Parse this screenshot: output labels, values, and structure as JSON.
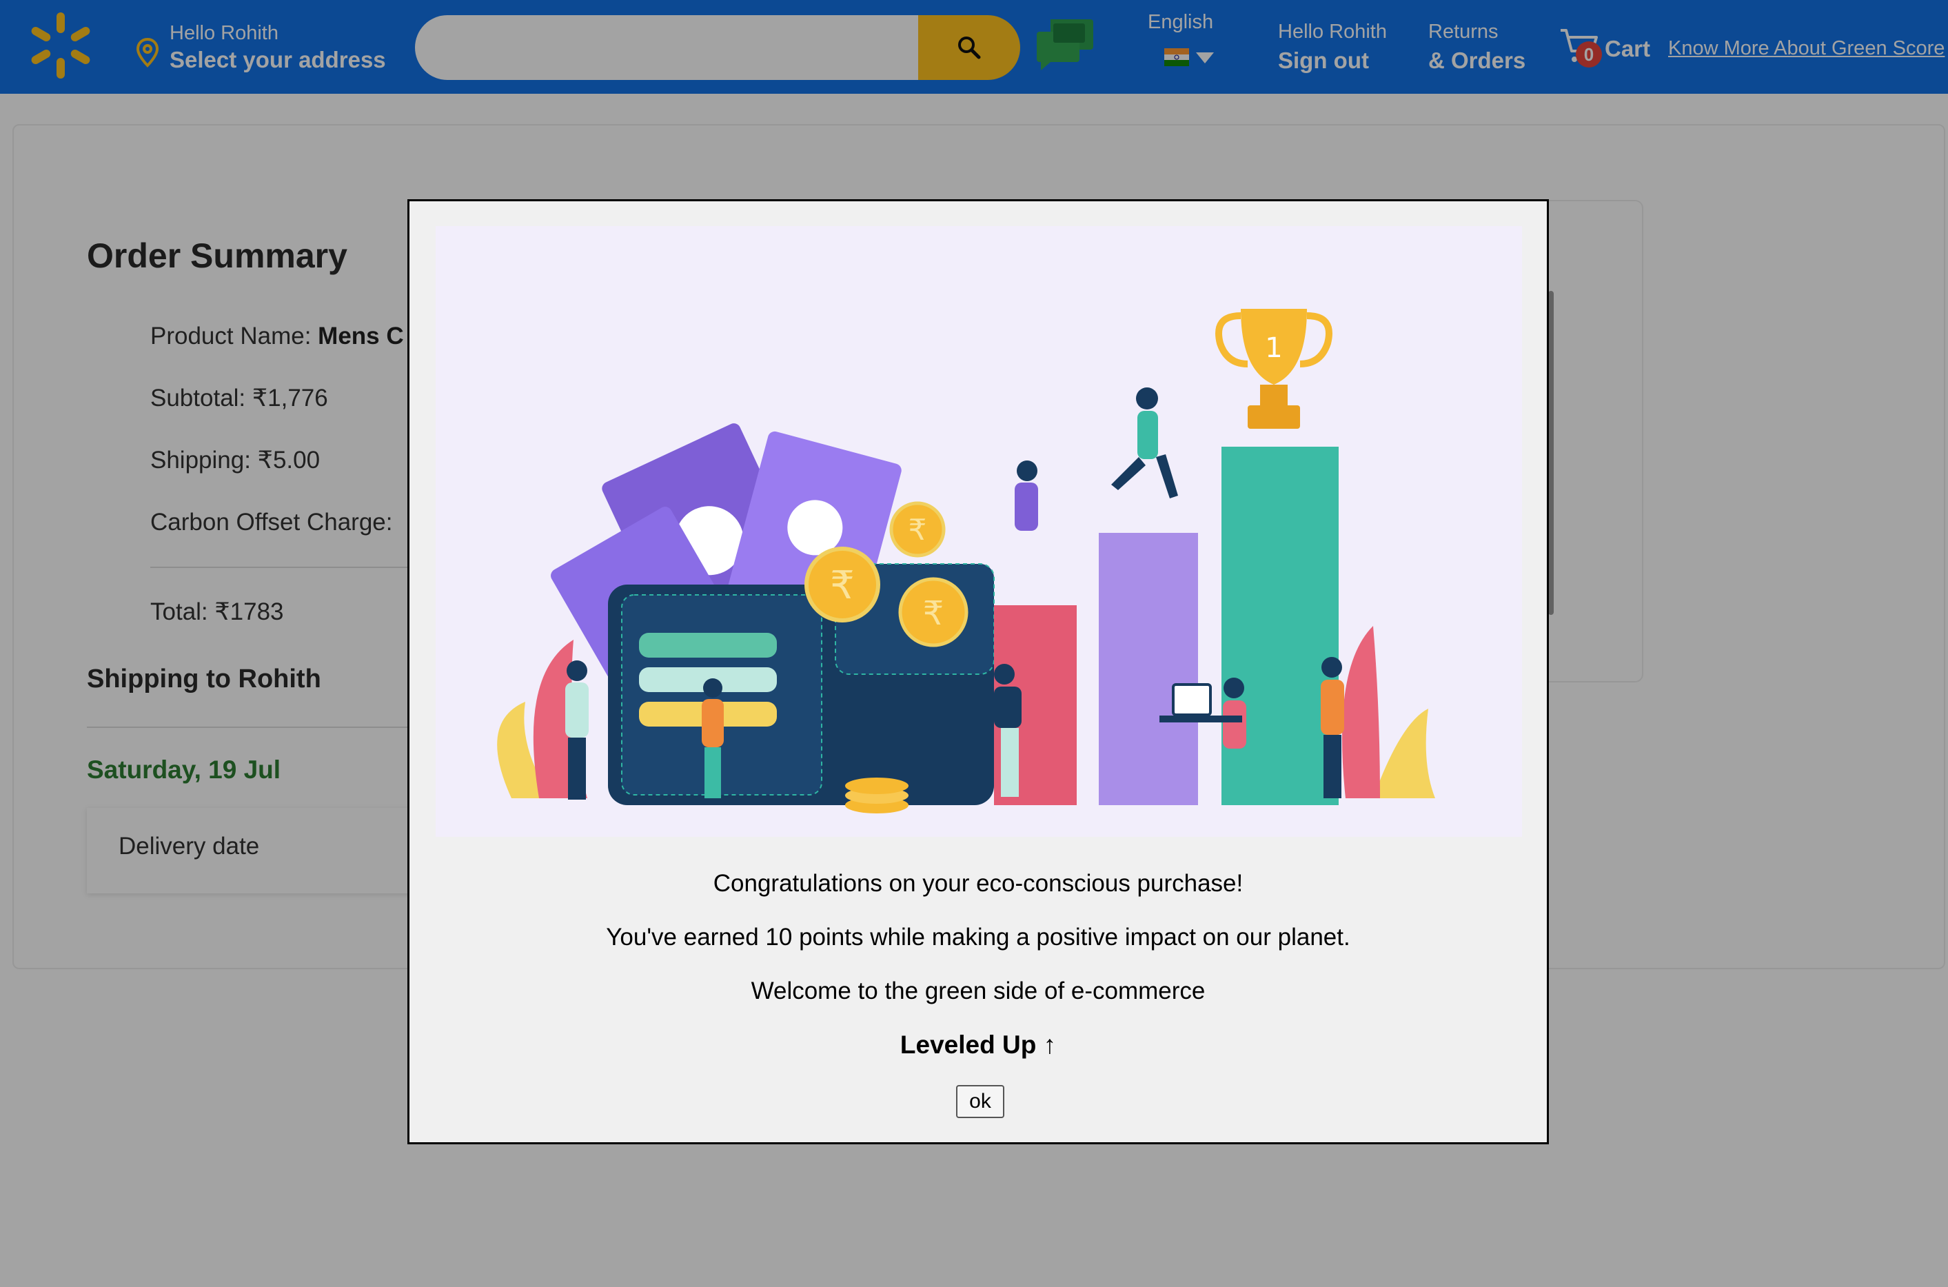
{
  "header": {
    "address_greeting": "Hello Rohith",
    "address_action": "Select your address",
    "search_value": "",
    "language": "English",
    "account_greeting": "Hello Rohith",
    "account_action": "Sign out",
    "returns_label": "Returns",
    "orders_label": "& Orders",
    "cart_count": "0",
    "cart_label": "Cart",
    "green_score_link": "Know More About Green Score"
  },
  "order_summary": {
    "title": "Order Summary",
    "product_name_label": "Product Name:",
    "product_name_value": "Mens C",
    "subtotal": "Subtotal: ₹1,776",
    "shipping": "Shipping: ₹5.00",
    "carbon_offset": "Carbon Offset Charge:",
    "total": "Total: ₹1783",
    "shipping_to": "Shipping to Rohith",
    "delivery_day": "Saturday, 19 Jul",
    "delivery_label": "Delivery date"
  },
  "modal": {
    "line1": "Congratulations on your eco-conscious purchase!",
    "line2": "You've earned 10 points while making a positive impact on our planet.",
    "line3": "Welcome to the green side of e-commerce",
    "line4": "Leveled Up ↑",
    "ok_label": "ok"
  },
  "icons": [
    "spark-logo-icon",
    "location-pin-icon",
    "search-icon",
    "chat-icon",
    "india-flag-icon",
    "chevron-down-icon",
    "cart-icon"
  ],
  "colors": {
    "header_bg": "#1473e6",
    "accent_yellow": "#ffc220",
    "badge_red": "#e8453c",
    "delivery_green": "#2e7d32"
  }
}
